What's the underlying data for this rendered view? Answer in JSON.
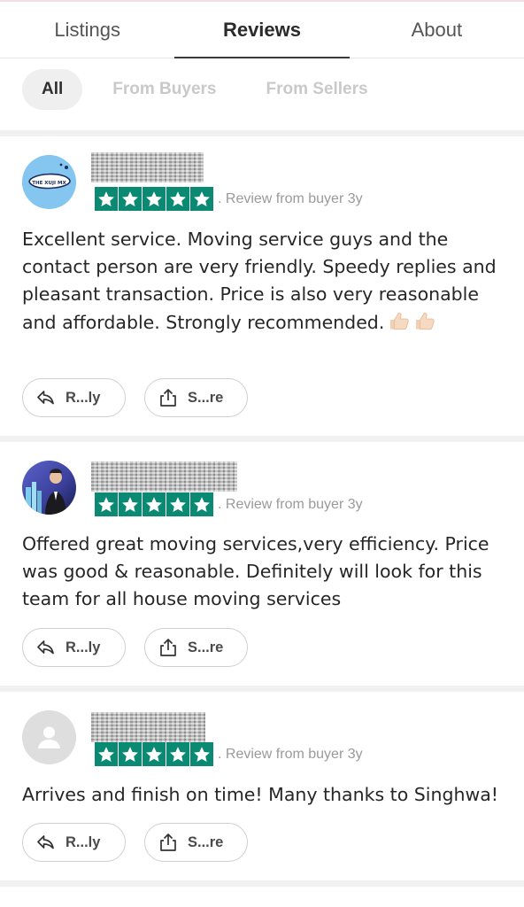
{
  "tabs": [
    {
      "label": "Listings",
      "active": false
    },
    {
      "label": "Reviews",
      "active": true
    },
    {
      "label": "About",
      "active": false
    }
  ],
  "filters": [
    {
      "label": "All",
      "active": true
    },
    {
      "label": "From Buyers",
      "active": false
    },
    {
      "label": "From Sellers",
      "active": false
    }
  ],
  "star_color": "#0b8a73",
  "reviews": [
    {
      "avatar": "the-xuji-mx-logo",
      "avatar_text": "THE XUJI MX",
      "rating": 5,
      "meta": ". Review from buyer 3y",
      "text": "Excellent service. Moving service guys and the contact person are very friendly.  Speedy replies and pleasant transaction. Price is also very reasonable and affordable. Strongly recommended.",
      "reply_label": "R...ly",
      "share_label": "S...re"
    },
    {
      "avatar": "user-photo",
      "rating": 5,
      "meta": ". Review from buyer 3y",
      "text": "Offered great moving services,very efficiency. Price was good & reasonable. Definitely will look for this team for all house moving services",
      "reply_label": "R...ly",
      "share_label": "S...re"
    },
    {
      "avatar": "default-user-icon",
      "rating": 5,
      "meta": ". Review from buyer 3y",
      "text": "Arrives and finish on time! Many thanks to Singhwa!",
      "reply_label": "R...ly",
      "share_label": "S...re"
    }
  ]
}
